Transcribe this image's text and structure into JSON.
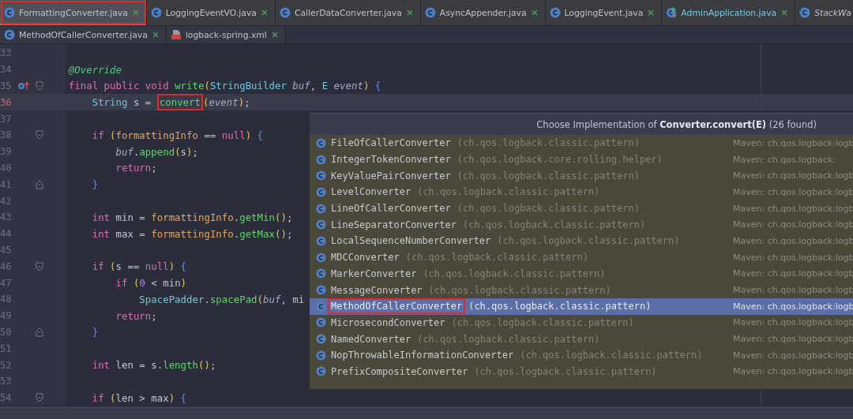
{
  "tab_rows": [
    {
      "tabs": [
        {
          "label": "FormattingConverter.java",
          "kind": "class",
          "selected": true,
          "boxed": true,
          "italic": false,
          "modified": false,
          "closable": true
        },
        {
          "label": "LoggingEventVO.java",
          "kind": "class",
          "selected": false,
          "boxed": false,
          "italic": false,
          "modified": false,
          "closable": true
        },
        {
          "label": "CallerDataConverter.java",
          "kind": "class",
          "selected": false,
          "boxed": false,
          "italic": false,
          "modified": false,
          "closable": true
        },
        {
          "label": "AsyncAppender.java",
          "kind": "class",
          "selected": false,
          "boxed": false,
          "italic": false,
          "modified": false,
          "closable": true
        },
        {
          "label": "LoggingEvent.java",
          "kind": "class",
          "selected": false,
          "boxed": false,
          "italic": false,
          "modified": false,
          "closable": true
        },
        {
          "label": "AdminApplication.java",
          "kind": "app",
          "selected": false,
          "boxed": false,
          "italic": false,
          "modified": true,
          "closable": true
        },
        {
          "label": "StackWa",
          "kind": "class",
          "selected": false,
          "boxed": false,
          "italic": true,
          "modified": false,
          "closable": false
        }
      ]
    },
    {
      "tabs": [
        {
          "label": "MethodOfCallerConverter.java",
          "kind": "class",
          "selected": false,
          "boxed": false,
          "italic": false,
          "modified": false,
          "closable": true
        },
        {
          "label": "logback-spring.xml",
          "kind": "xml",
          "selected": false,
          "boxed": false,
          "italic": false,
          "modified": false,
          "closable": true
        }
      ]
    }
  ],
  "code_lines": [
    {
      "number": "33",
      "current": false,
      "fold_start": false,
      "fold_end": false,
      "implements_marker": false
    },
    {
      "number": "34",
      "current": false,
      "fold_start": false,
      "fold_end": false,
      "implements_marker": false,
      "tokens": [
        {
          "t": "    @Override",
          "kind": "annotation"
        }
      ]
    },
    {
      "number": "35",
      "current": false,
      "fold_start": true,
      "fold_end": false,
      "implements_marker": true,
      "tokens": [
        {
          "t": "    final public void ",
          "kind": "keyword"
        },
        {
          "t": "write",
          "kind": "method"
        },
        {
          "t": "(",
          "kind": "paren"
        },
        {
          "t": "StringBuilder ",
          "kind": "type"
        },
        {
          "t": "buf",
          "kind": "param"
        },
        {
          "t": ", ",
          "kind": "plain"
        },
        {
          "t": "E ",
          "kind": "type"
        },
        {
          "t": "event",
          "kind": "param"
        },
        {
          "t": ") ",
          "kind": "paren"
        },
        {
          "t": "{",
          "kind": "brace"
        }
      ]
    },
    {
      "number": "36",
      "current": true,
      "fold_start": false,
      "fold_end": false,
      "implements_marker": false,
      "tokens": [
        {
          "t": "        String",
          "kind": "type"
        },
        {
          "t": " s = ",
          "kind": "plain"
        },
        {
          "t": "convert",
          "kind": "method",
          "boxed": true
        },
        {
          "t": "(",
          "kind": "paren"
        },
        {
          "t": "event",
          "kind": "param"
        },
        {
          "t": ")",
          "kind": "paren"
        },
        {
          "t": ";",
          "kind": "plain"
        }
      ]
    },
    {
      "number": "37",
      "current": false,
      "fold_start": false,
      "fold_end": false,
      "implements_marker": false
    },
    {
      "number": "38",
      "current": false,
      "fold_start": true,
      "fold_end": false,
      "implements_marker": false,
      "tokens": [
        {
          "t": "        if ",
          "kind": "keyword"
        },
        {
          "t": "(",
          "kind": "paren"
        },
        {
          "t": "formattingInfo",
          "kind": "field"
        },
        {
          "t": " == ",
          "kind": "plain"
        },
        {
          "t": "null",
          "kind": "keyword"
        },
        {
          "t": ") ",
          "kind": "paren"
        },
        {
          "t": "{",
          "kind": "brace"
        }
      ]
    },
    {
      "number": "39",
      "current": false,
      "fold_start": false,
      "fold_end": false,
      "implements_marker": false,
      "tokens": [
        {
          "t": "            buf",
          "kind": "param"
        },
        {
          "t": ".",
          "kind": "plain"
        },
        {
          "t": "append",
          "kind": "method"
        },
        {
          "t": "(",
          "kind": "paren"
        },
        {
          "t": "s",
          "kind": "plain"
        },
        {
          "t": ")",
          "kind": "paren"
        },
        {
          "t": ";",
          "kind": "plain"
        }
      ]
    },
    {
      "number": "40",
      "current": false,
      "fold_start": false,
      "fold_end": false,
      "implements_marker": false,
      "tokens": [
        {
          "t": "            return",
          "kind": "keyword"
        },
        {
          "t": ";",
          "kind": "plain"
        }
      ]
    },
    {
      "number": "41",
      "current": false,
      "fold_start": false,
      "fold_end": true,
      "implements_marker": false,
      "tokens": [
        {
          "t": "        }",
          "kind": "brace"
        }
      ]
    },
    {
      "number": "42",
      "current": false,
      "fold_start": false,
      "fold_end": false,
      "implements_marker": false
    },
    {
      "number": "43",
      "current": false,
      "fold_start": false,
      "fold_end": false,
      "implements_marker": false,
      "tokens": [
        {
          "t": "        int",
          "kind": "keyword"
        },
        {
          "t": " min = ",
          "kind": "plain"
        },
        {
          "t": "formattingInfo",
          "kind": "field"
        },
        {
          "t": ".",
          "kind": "plain"
        },
        {
          "t": "getMin",
          "kind": "method"
        },
        {
          "t": "()",
          "kind": "paren"
        },
        {
          "t": ";",
          "kind": "plain"
        }
      ]
    },
    {
      "number": "44",
      "current": false,
      "fold_start": false,
      "fold_end": false,
      "implements_marker": false,
      "tokens": [
        {
          "t": "        int",
          "kind": "keyword"
        },
        {
          "t": " max = ",
          "kind": "plain"
        },
        {
          "t": "formattingInfo",
          "kind": "field"
        },
        {
          "t": ".",
          "kind": "plain"
        },
        {
          "t": "getMax",
          "kind": "method"
        },
        {
          "t": "()",
          "kind": "paren"
        },
        {
          "t": ";",
          "kind": "plain"
        }
      ]
    },
    {
      "number": "45",
      "current": false,
      "fold_start": false,
      "fold_end": false,
      "implements_marker": false
    },
    {
      "number": "46",
      "current": false,
      "fold_start": true,
      "fold_end": false,
      "implements_marker": false,
      "tokens": [
        {
          "t": "        if ",
          "kind": "keyword"
        },
        {
          "t": "(",
          "kind": "paren"
        },
        {
          "t": "s == ",
          "kind": "plain"
        },
        {
          "t": "null",
          "kind": "keyword"
        },
        {
          "t": ") ",
          "kind": "paren"
        },
        {
          "t": "{",
          "kind": "brace"
        }
      ]
    },
    {
      "number": "47",
      "current": false,
      "fold_start": false,
      "fold_end": false,
      "implements_marker": false,
      "tokens": [
        {
          "t": "            if ",
          "kind": "keyword"
        },
        {
          "t": "(",
          "kind": "paren"
        },
        {
          "t": "0",
          "kind": "number"
        },
        {
          "t": " < min",
          "kind": "plain"
        },
        {
          "t": ")",
          "kind": "paren"
        }
      ]
    },
    {
      "number": "48",
      "current": false,
      "fold_start": false,
      "fold_end": false,
      "implements_marker": false,
      "tokens": [
        {
          "t": "                SpacePadder",
          "kind": "type"
        },
        {
          "t": ".",
          "kind": "plain"
        },
        {
          "t": "spacePad",
          "kind": "method"
        },
        {
          "t": "(",
          "kind": "paren"
        },
        {
          "t": "buf",
          "kind": "param"
        },
        {
          "t": ", mi",
          "kind": "plain"
        }
      ]
    },
    {
      "number": "49",
      "current": false,
      "fold_start": false,
      "fold_end": false,
      "implements_marker": false,
      "tokens": [
        {
          "t": "            return",
          "kind": "keyword"
        },
        {
          "t": ";",
          "kind": "plain"
        }
      ]
    },
    {
      "number": "50",
      "current": false,
      "fold_start": false,
      "fold_end": true,
      "implements_marker": false,
      "tokens": [
        {
          "t": "        }",
          "kind": "brace"
        }
      ]
    },
    {
      "number": "51",
      "current": false,
      "fold_start": false,
      "fold_end": false,
      "implements_marker": false
    },
    {
      "number": "52",
      "current": false,
      "fold_start": false,
      "fold_end": false,
      "implements_marker": false,
      "tokens": [
        {
          "t": "        int",
          "kind": "keyword"
        },
        {
          "t": " len = s.",
          "kind": "plain"
        },
        {
          "t": "length",
          "kind": "method"
        },
        {
          "t": "()",
          "kind": "paren"
        },
        {
          "t": ";",
          "kind": "plain"
        }
      ]
    },
    {
      "number": "53",
      "current": false,
      "fold_start": false,
      "fold_end": false,
      "implements_marker": false
    },
    {
      "number": "54",
      "current": false,
      "fold_start": true,
      "fold_end": false,
      "implements_marker": false,
      "tokens": [
        {
          "t": "        if ",
          "kind": "keyword"
        },
        {
          "t": "(",
          "kind": "paren"
        },
        {
          "t": "len > max",
          "kind": "plain"
        },
        {
          "t": ") ",
          "kind": "paren"
        },
        {
          "t": "{",
          "kind": "brace"
        }
      ]
    }
  ],
  "popup": {
    "title": "Choose Implementation of **Converter.convert(E)** (26 found)",
    "items": [
      {
        "name": "FileOfCallerConverter",
        "package": "(ch.qos.logback.classic.pattern)",
        "source": "Maven: ch.qos.logback:logb",
        "kind": "class",
        "selected": false,
        "boxed": false
      },
      {
        "name": "IntegerTokenConverter",
        "package": "(ch.qos.logback.core.rolling.helper)",
        "source": "Maven: ch.qos.logback:",
        "kind": "class",
        "selected": false,
        "boxed": false
      },
      {
        "name": "KeyValuePairConverter",
        "package": "(ch.qos.logback.classic.pattern)",
        "source": "Maven: ch.qos.logback:logb",
        "kind": "class",
        "selected": false,
        "boxed": false
      },
      {
        "name": "LevelConverter",
        "package": "(ch.qos.logback.classic.pattern)",
        "source": "Maven: ch.qos.logback:logb",
        "kind": "class",
        "selected": false,
        "boxed": false
      },
      {
        "name": "LineOfCallerConverter",
        "package": "(ch.qos.logback.classic.pattern)",
        "source": "Maven: ch.qos.logback:logb",
        "kind": "class",
        "selected": false,
        "boxed": false
      },
      {
        "name": "LineSeparatorConverter",
        "package": "(ch.qos.logback.classic.pattern)",
        "source": "Maven: ch.qos.logback:logb",
        "kind": "class",
        "selected": false,
        "boxed": false
      },
      {
        "name": "LocalSequenceNumberConverter",
        "package": "(ch.qos.logback.classic.pattern)",
        "source": "Maven: ch.qos.logback:logb",
        "kind": "class",
        "selected": false,
        "boxed": false
      },
      {
        "name": "MDCConverter",
        "package": "(ch.qos.logback.classic.pattern)",
        "source": "Maven: ch.qos.logback:logb",
        "kind": "class",
        "selected": false,
        "boxed": false
      },
      {
        "name": "MarkerConverter",
        "package": "(ch.qos.logback.classic.pattern)",
        "source": "Maven: ch.qos.logback:logb",
        "kind": "class",
        "selected": false,
        "boxed": false
      },
      {
        "name": "MessageConverter",
        "package": "(ch.qos.logback.classic.pattern)",
        "source": "Maven: ch.qos.logback:logb",
        "kind": "class",
        "selected": false,
        "boxed": false
      },
      {
        "name": "MethodOfCallerConverter",
        "package": "(ch.qos.logback.classic.pattern)",
        "source": "Maven: ch.qos.logback:logb",
        "kind": "class",
        "selected": true,
        "boxed": true
      },
      {
        "name": "MicrosecondConverter",
        "package": "(ch.qos.logback.classic.pattern)",
        "source": "Maven: ch.qos.logback:logb",
        "kind": "class",
        "selected": false,
        "boxed": false
      },
      {
        "name": "NamedConverter",
        "package": "(ch.qos.logback.classic.pattern)",
        "source": "Maven: ch.qos.logback:logb",
        "kind": "abstract",
        "selected": false,
        "boxed": false
      },
      {
        "name": "NopThrowableInformationConverter",
        "package": "(ch.qos.logback.classic.pattern)",
        "source": "Maven: ch.qos.logback:logb",
        "kind": "class",
        "selected": false,
        "boxed": false
      },
      {
        "name": "PrefixCompositeConverter",
        "package": "(ch.qos.logback.classic.pattern)",
        "source": "Maven: ch.qos.logback:logb",
        "kind": "class",
        "selected": false,
        "boxed": false
      }
    ]
  }
}
